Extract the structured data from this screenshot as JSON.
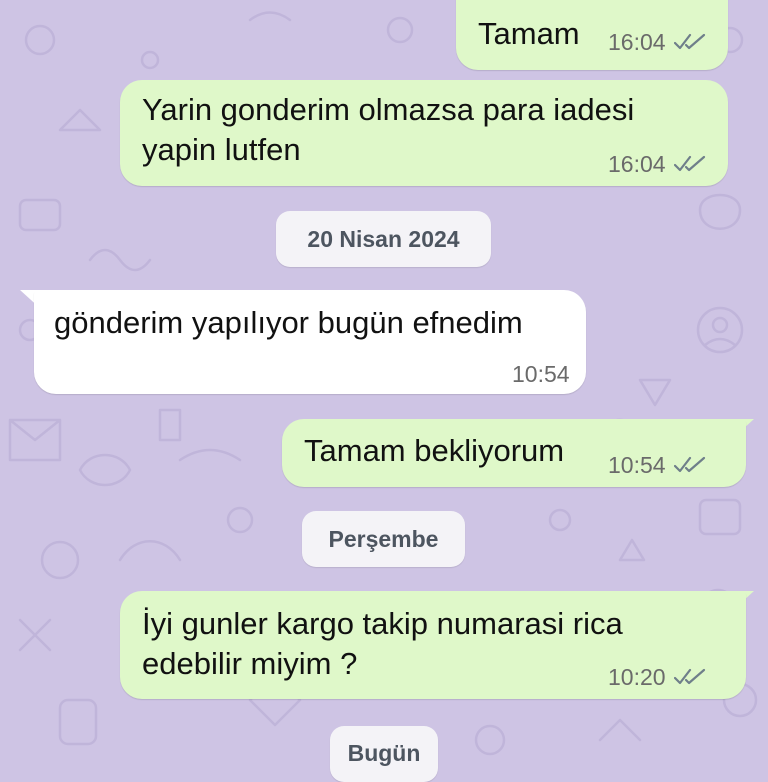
{
  "colors": {
    "wallpaper": "#cec4e4",
    "outgoing_bubble": "#dff8c9",
    "incoming_bubble": "#ffffff",
    "read_ticks": "#6f7f8a"
  },
  "messages": [
    {
      "direction": "outgoing",
      "text": "Tamam",
      "time": "16:04",
      "status_icon": "double-check-icon"
    },
    {
      "direction": "outgoing",
      "text": "Yarin gonderim olmazsa para iadesi\nyapin lutfen",
      "time": "16:04",
      "status_icon": "double-check-icon"
    },
    {
      "direction": "incoming",
      "text": "gönderim yapılıyor bugün efnedim",
      "time": "10:54"
    },
    {
      "direction": "outgoing",
      "text": "Tamam bekliyorum",
      "time": "10:54",
      "status_icon": "double-check-icon"
    },
    {
      "direction": "outgoing",
      "text": "İyi gunler kargo takip numarasi rica\nedebilir miyim ?",
      "time": "10:20",
      "status_icon": "double-check-icon"
    }
  ],
  "date_separators": [
    {
      "label": "20 Nisan 2024"
    },
    {
      "label": "Perşembe"
    },
    {
      "label": "Bugün"
    }
  ]
}
